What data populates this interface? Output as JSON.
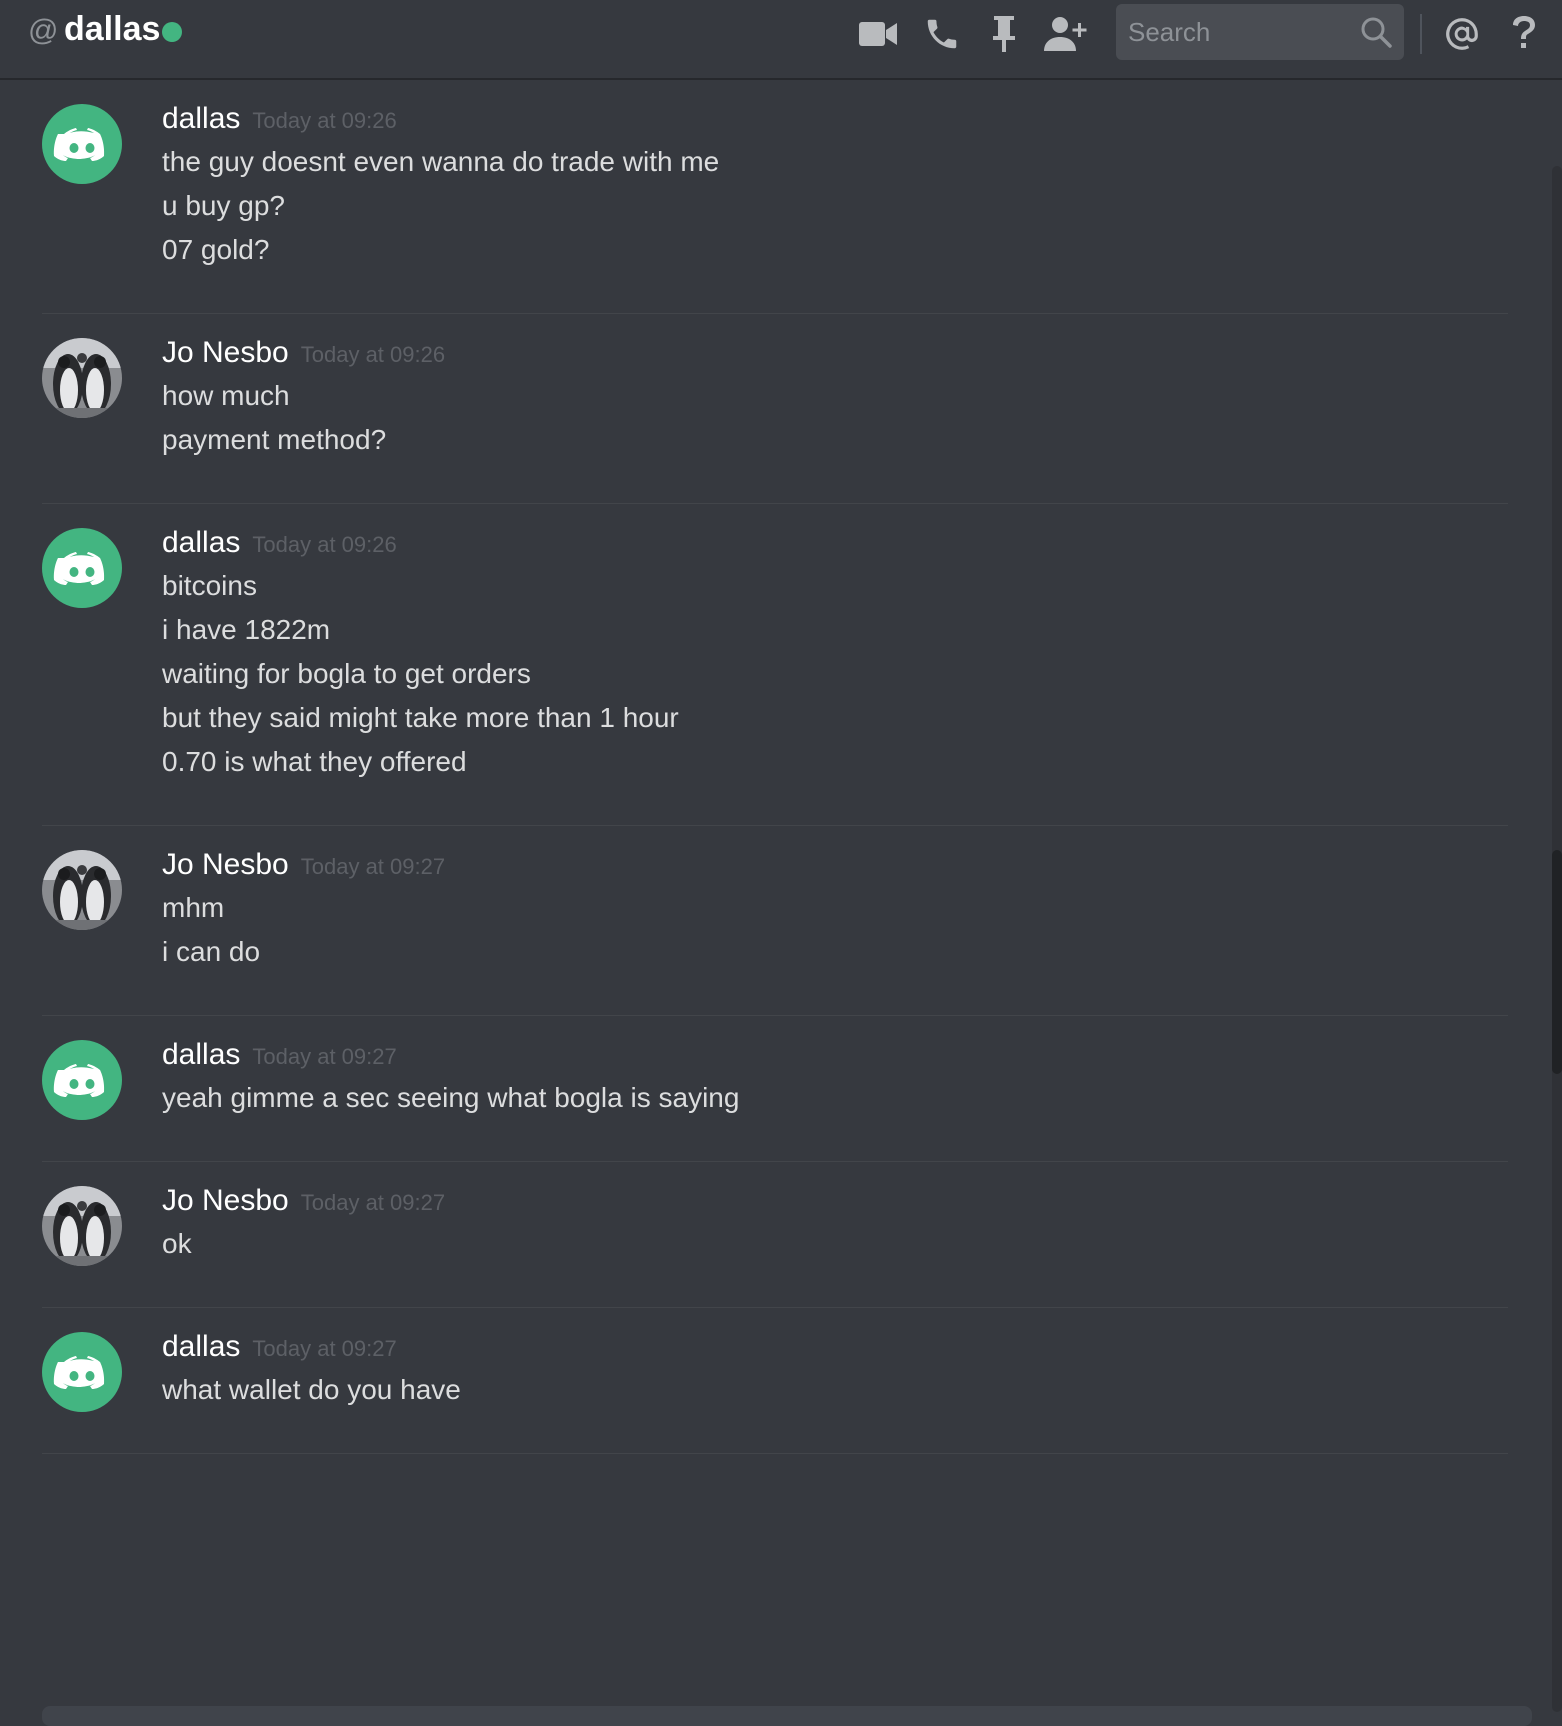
{
  "header": {
    "at_symbol": "@",
    "dm_name": "dallas",
    "search_placeholder": "Search",
    "status_color": "#43b581"
  },
  "icons": {
    "video": "video-camera-icon",
    "call": "phone-icon",
    "pin": "pin-icon",
    "add_friend": "add-user-icon",
    "search": "search-icon",
    "mention": "at-mention-icon",
    "help": "help-icon"
  },
  "colors": {
    "background": "#36393f",
    "avatar_green": "#43b581",
    "timestamp": "#5d6066",
    "text": "#dcddde"
  },
  "messages": [
    {
      "author": "dallas",
      "avatar": "discord-default-avatar",
      "timestamp": "Today at 09:26",
      "lines": [
        "the guy doesnt even wanna do trade with me",
        "u buy gp?",
        "07 gold?"
      ]
    },
    {
      "author": "Jo Nesbo",
      "avatar": "penguin-photo-avatar",
      "timestamp": "Today at 09:26",
      "lines": [
        "how much",
        "payment method?"
      ]
    },
    {
      "author": "dallas",
      "avatar": "discord-default-avatar",
      "timestamp": "Today at 09:26",
      "lines": [
        "bitcoins",
        "i have 1822m",
        "waiting for bogla to get orders",
        "but they said might take more than 1 hour",
        "0.70 is what they offered"
      ]
    },
    {
      "author": "Jo Nesbo",
      "avatar": "penguin-photo-avatar",
      "timestamp": "Today at 09:27",
      "lines": [
        "mhm",
        "i can do"
      ]
    },
    {
      "author": "dallas",
      "avatar": "discord-default-avatar",
      "timestamp": "Today at 09:27",
      "lines": [
        "yeah gimme a sec seeing what bogla is saying"
      ]
    },
    {
      "author": "Jo Nesbo",
      "avatar": "penguin-photo-avatar",
      "timestamp": "Today at 09:27",
      "lines": [
        "ok"
      ]
    },
    {
      "author": "dallas",
      "avatar": "discord-default-avatar",
      "timestamp": "Today at 09:27",
      "lines": [
        "what wallet do you have"
      ]
    }
  ]
}
